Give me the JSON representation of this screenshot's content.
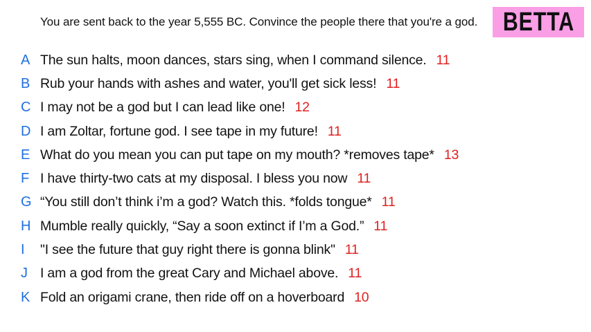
{
  "prompt": "You are sent back to the year 5,555 BC. Convince the people there that you're a god.",
  "badge": "BETTA",
  "colors": {
    "badge_bg": "#fa9ee6",
    "letter": "#1e6fe0",
    "score": "#e02020",
    "text": "#111111"
  },
  "answers": [
    {
      "letter": "A",
      "text": "The sun halts, moon dances, stars sing, when I command silence.",
      "score": "11"
    },
    {
      "letter": "B",
      "text": "Rub your hands with ashes and water, you'll get sick less!",
      "score": "11"
    },
    {
      "letter": "C",
      "text": "I may not be a god but I can lead like one!",
      "score": "12"
    },
    {
      "letter": "D",
      "text": "I am Zoltar, fortune god. I see tape in my future!",
      "score": "11"
    },
    {
      "letter": "E",
      "text": "What do you mean you can put tape on my mouth? *removes tape*",
      "score": "13"
    },
    {
      "letter": "F",
      "text": "I have thirty-two cats at my disposal. I bless you now",
      "score": "11"
    },
    {
      "letter": "G",
      "text": "“You still don’t think i’m a god? Watch this.  *folds tongue*",
      "score": "11"
    },
    {
      "letter": "H",
      "text": "Mumble really quickly, “Say a soon extinct if I’m a God.”",
      "score": "11"
    },
    {
      "letter": "I",
      "text": "\"I see the future that guy right there is gonna blink\"",
      "score": "11"
    },
    {
      "letter": "J",
      "text": "I am a god from the great Cary and Michael above.",
      "score": "11"
    },
    {
      "letter": "K",
      "text": "Fold an origami crane, then ride off on a hoverboard",
      "score": "10"
    }
  ]
}
